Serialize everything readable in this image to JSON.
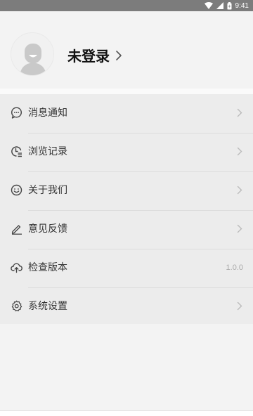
{
  "status_bar": {
    "time": "9:41",
    "icons": [
      "wifi-icon",
      "cellular-signal-icon",
      "battery-icon"
    ]
  },
  "profile": {
    "login_label": "未登录",
    "avatar_icon": "default-avatar-icon",
    "chevron_icon": "chevron-right-icon"
  },
  "menu": {
    "items": [
      {
        "label": "消息通知",
        "icon": "message-bubble-icon",
        "trailing": "chevron-right-icon"
      },
      {
        "label": "浏览记录",
        "icon": "history-clock-icon",
        "trailing": "chevron-right-icon"
      },
      {
        "label": "关于我们",
        "icon": "smiley-face-icon",
        "trailing": "chevron-right-icon"
      },
      {
        "label": "意见反馈",
        "icon": "edit-pencil-icon",
        "trailing": "chevron-right-icon"
      },
      {
        "label": "检查版本",
        "icon": "cloud-upload-icon",
        "value": "1.0.0"
      },
      {
        "label": "系统设置",
        "icon": "gear-icon",
        "trailing": "chevron-right-icon"
      }
    ]
  },
  "colors": {
    "status_bar": "#7c7c7c",
    "page_background": "#f3f3f3",
    "menu_background": "#ececec",
    "divider": "#dcdcdc",
    "primary_text": "#333333",
    "secondary_text": "#aaaaaa"
  }
}
